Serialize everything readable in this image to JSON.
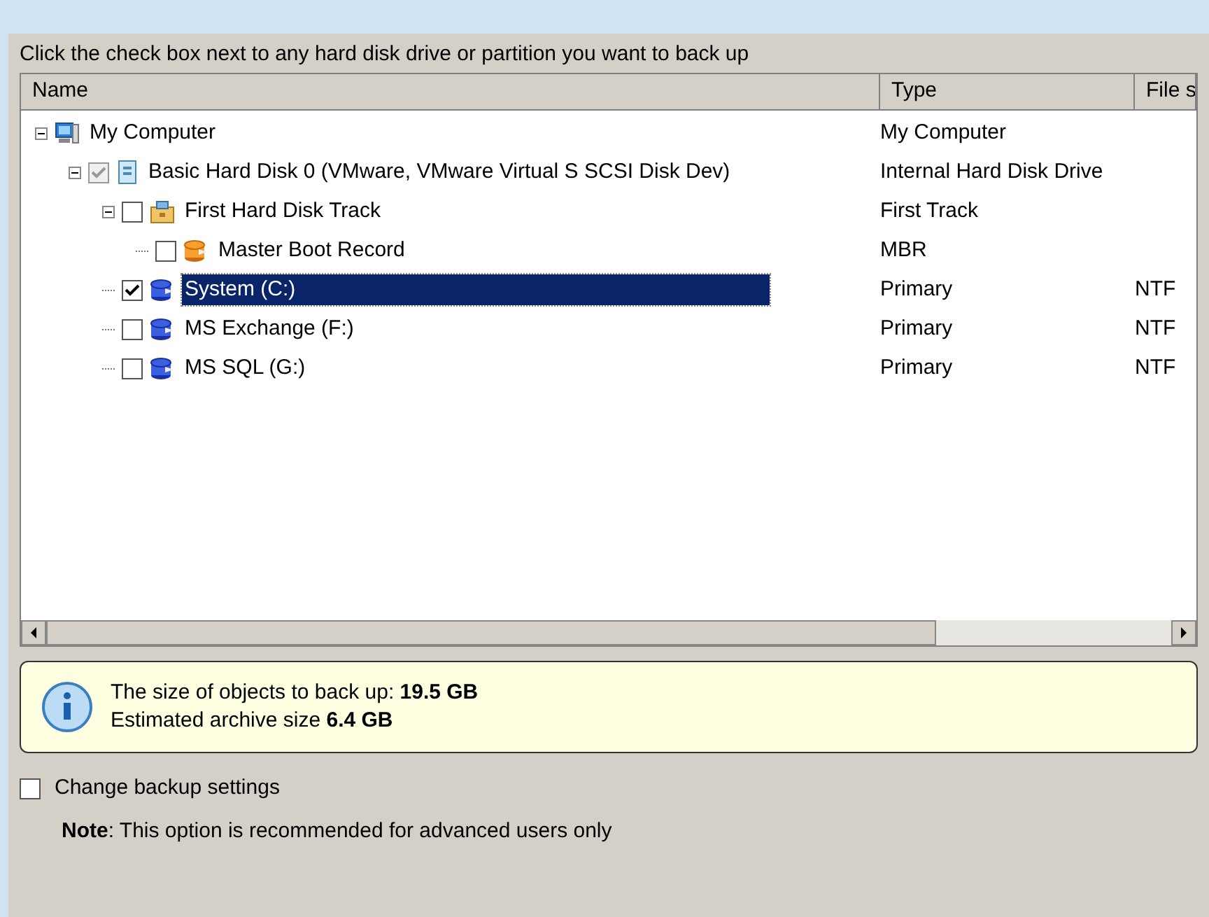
{
  "instruction": "Click the check box next to any hard disk drive or partition you want to back up",
  "table": {
    "columns": [
      "Name",
      "Type",
      "File s"
    ],
    "tree": [
      {
        "name": "My Computer",
        "kind": "computer",
        "type": "My Computer",
        "expanded": true,
        "children": [
          {
            "name": "Basic Hard Disk 0 (VMware, VMware Virtual S SCSI Disk Dev)",
            "kind": "disk",
            "type": "Internal Hard Disk Drive",
            "checked": true,
            "disabled": true,
            "expanded": true,
            "children": [
              {
                "name": "First Hard Disk Track",
                "kind": "track",
                "type": "First Track",
                "checked": false,
                "disabled": false,
                "expanded": true,
                "children": [
                  {
                    "name": "Master Boot Record",
                    "kind": "mbr",
                    "type": "MBR",
                    "checked": false,
                    "disabled": false
                  }
                ]
              },
              {
                "name": "System (C:)",
                "kind": "volume",
                "type": "Primary",
                "file_system": "NTF",
                "checked": true,
                "disabled": false,
                "selected": true
              },
              {
                "name": "MS Exchange (F:)",
                "kind": "volume",
                "type": "Primary",
                "file_system": "NTF",
                "checked": false,
                "disabled": false,
                "selected": false
              },
              {
                "name": "MS SQL (G:)",
                "kind": "volume",
                "type": "Primary",
                "file_system": "NTF",
                "checked": false,
                "disabled": false,
                "selected": false
              }
            ]
          }
        ]
      }
    ]
  },
  "info": {
    "lines": [
      "The size of objects to back up:  **19.5 GB**",
      "Estimated archive size  **6.4 GB**"
    ]
  },
  "change_settings": {
    "label": "Change backup settings",
    "checked": false
  },
  "note": "**Note**: This option is recommended for advanced users only"
}
